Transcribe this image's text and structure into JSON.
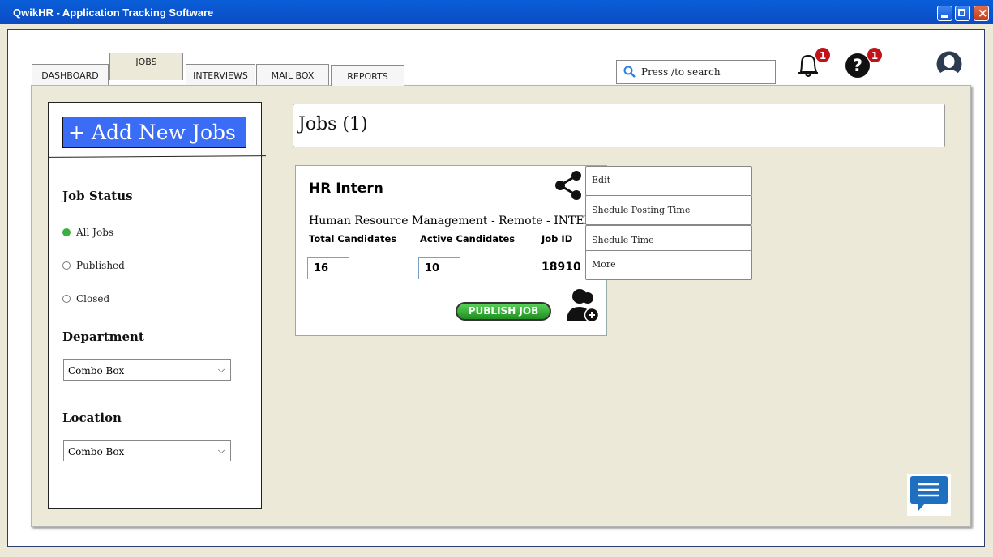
{
  "window": {
    "title": "QwikHR - Application Tracking Software"
  },
  "tabs": [
    {
      "label": "DASHBOARD",
      "active": false
    },
    {
      "label": "JOBS",
      "active": true
    },
    {
      "label": "INTERVIEWS",
      "active": false
    },
    {
      "label": "MAIL BOX",
      "active": false
    },
    {
      "label": "REPORTS",
      "active": false
    }
  ],
  "search": {
    "placeholder": "Press /to search"
  },
  "notifications": {
    "count": "1"
  },
  "help": {
    "count": "1"
  },
  "sidebar": {
    "add_button": "+ Add New Jobs",
    "job_status_label": "Job Status",
    "status_options": [
      {
        "label": "All Jobs",
        "selected": true
      },
      {
        "label": "Published",
        "selected": false
      },
      {
        "label": "Closed",
        "selected": false
      }
    ],
    "department_label": "Department",
    "department_value": "Combo Box",
    "location_label": "Location",
    "location_value": "Combo Box"
  },
  "main": {
    "header": "Jobs (1)"
  },
  "job_card": {
    "title": "HR Intern",
    "subtitle": "Human Resource Management - Remote - INTERN",
    "total_label": "Total Candidates",
    "active_label": "Active Candidates",
    "jobid_label": "Job ID",
    "total": "16",
    "active": "10",
    "job_id": "18910",
    "publish_label": "PUBLISH JOB"
  },
  "context_menu": [
    "Edit",
    "Shedule Posting Time",
    "Shedule Time",
    "More"
  ],
  "colors": {
    "titlebar": "#0b55d0",
    "add_button": "#3b6cf5",
    "badge": "#c0141a",
    "publish": "#2ea52f",
    "chat": "#1f6fc0"
  }
}
